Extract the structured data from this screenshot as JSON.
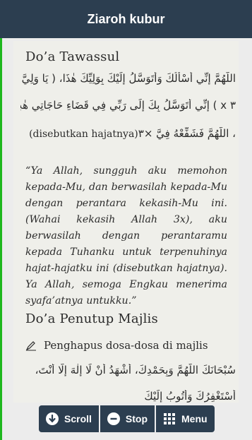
{
  "header": {
    "title": "Ziaroh kubur"
  },
  "page": {
    "section1": {
      "heading": "Do’a Tawassul",
      "arabic_line1": "اللَّهُمَّ إِنِّي أَسْأَلُكَ وَأَتَوَسَّلُ إِلَيْكَ بِوَلِيِّكَ هٰذَا، ( يَا وَلِيَّ اللهِ",
      "arabic_line2": "٣ x ) إِنِّي أَتَوَسَّلُ بِكَ إِلَى رَبِّي فِي قَضَاءِ حَاجَاتِي هٰذِهِ ...",
      "arabic_line3_latin": "(disebutkan hajatnya)",
      "arabic_line3_ar": "، اللَّهُمَّ فَشَفِّعْهُ فِيَّ ×٣",
      "translation": "“Ya Allah, sungguh aku memohon kepada-Mu, dan berwasilah kepada-Mu dengan perantara kekasih-Mu ini. (Wahai kekasih Allah 3x), aku berwasilah dengan perantaramu kepada Tuhanku untuk terpenuhinya hajat-hajatku ini (disebutkan hajatnya). Ya Allah, semoga Engkau menerima syafa’atnya untukku.”"
    },
    "section2": {
      "heading": "Do’a Penutup Majlis",
      "bullet_text": "Penghapus dosa-dosa di majlis",
      "bullet_icon": "pen-icon",
      "arabic_line1": "سُبْحَانَكَ اللَّهُمَّ وَبِحَمْدِكَ، أَشْهَدُ أَنْ لَا إِلٰهَ إِلَّا أَنْتَ،",
      "arabic_line2": "أَسْتَغْفِرُكَ وَأَتُوبُ إِلَيْكَ"
    }
  },
  "toolbar": {
    "scroll_label": "Scroll",
    "stop_label": "Stop",
    "menu_label": "Menu"
  },
  "colors": {
    "titlebar": "#2c3e50",
    "accent_border": "#1fb81f",
    "page_bg": "#efefea",
    "frame_bg": "#ececec"
  }
}
